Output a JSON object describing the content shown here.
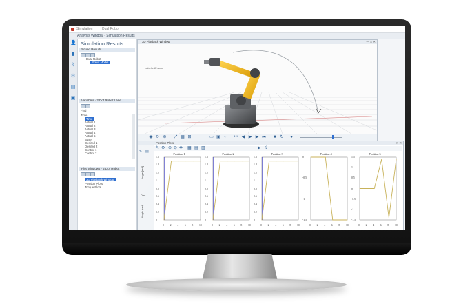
{
  "window": {
    "title": "Simulation",
    "subtitle": "Dual Robot",
    "tab": "Analysis Window · Simulation Results"
  },
  "left_panel": {
    "title": "Simulation Results",
    "sound_results": {
      "header": "Sound Results",
      "items": [
        "Dual Robot",
        "Robot Model"
      ]
    },
    "variables": {
      "header": "Variables · 2 Dof Robot Lane...",
      "filter_label": "Find",
      "tree_root": "Time",
      "items": [
        "Time",
        "Actual 1",
        "Actual 2",
        "Actual 3",
        "Actual 4",
        "Actual 5",
        "Base",
        "Desired 1",
        "Desired 2",
        "Control 1",
        "Control 2"
      ]
    },
    "plot_windows": {
      "header": "Plot Windows · 2 Dof Robot",
      "items": [
        "3D Playback Window",
        "Position Plots",
        "Torque Plots"
      ]
    }
  },
  "window_3d": {
    "title": "3D Playback Window",
    "scene_label": "LabelledFrame"
  },
  "plot_window": {
    "title": "Position Plots",
    "side_labels": [
      "Angle [rad]",
      "Dev",
      "Angle [rad]"
    ]
  },
  "colors": {
    "accent": "#2f6fd0",
    "robot_yellow": "#f2b418",
    "plot_line": "#c8b25a",
    "ref_line": "#2b2bd6",
    "bezel": "#1b1b1b"
  },
  "chart_data": [
    {
      "type": "line",
      "title": "Position 1",
      "x": [
        0,
        2,
        4,
        6,
        8,
        10
      ],
      "ylim": [
        0,
        1.6
      ],
      "yticks": [
        0,
        0.2,
        0.4,
        0.6,
        0.8,
        1,
        1.2,
        1.4,
        1.6
      ],
      "xticks": [
        0,
        2,
        4,
        6,
        8,
        10
      ],
      "series": [
        {
          "values": [
            0,
            1.5,
            1.5,
            1.5,
            1.5,
            1.5
          ]
        }
      ]
    },
    {
      "type": "line",
      "title": "Position 2",
      "x": [
        0,
        2,
        4,
        6,
        8,
        10
      ],
      "ylim": [
        0,
        1.6
      ],
      "yticks": [
        0,
        0.2,
        0.4,
        0.6,
        0.8,
        1,
        1.2,
        1.4,
        1.6
      ],
      "xticks": [
        0,
        2,
        4,
        6,
        8,
        10
      ],
      "series": [
        {
          "values": [
            0,
            1.5,
            1.5,
            1.5,
            1.5,
            1.5
          ]
        }
      ]
    },
    {
      "type": "line",
      "title": "Position 3",
      "x": [
        0,
        2,
        4,
        6,
        8,
        10
      ],
      "ylim": [
        0,
        1.6
      ],
      "yticks": [
        0,
        0.2,
        0.4,
        0.6,
        0.8,
        1,
        1.2,
        1.4,
        1.6
      ],
      "xticks": [
        0,
        2,
        4,
        6,
        8,
        10
      ],
      "series": [
        {
          "values": [
            0,
            1.5,
            1.5,
            1.5,
            1.5,
            1.5
          ]
        }
      ]
    },
    {
      "type": "line",
      "title": "Position 4",
      "x": [
        0,
        2,
        4,
        6,
        8,
        10
      ],
      "ylim": [
        -1.5,
        0
      ],
      "yticks": [
        0,
        -0.5,
        -1,
        -1.5
      ],
      "xticks": [
        0,
        2,
        4,
        6,
        8,
        10
      ],
      "series": [
        {
          "values": [
            0,
            0,
            0,
            -1.5,
            -1.5,
            -1.5
          ]
        }
      ]
    },
    {
      "type": "line",
      "title": "Position 5",
      "x": [
        0,
        2,
        4,
        6,
        8,
        10
      ],
      "ylim": [
        -1.5,
        1.5
      ],
      "yticks": [
        1.5,
        1,
        0.5,
        0,
        -0.5,
        -1,
        -1.5
      ],
      "xticks": [
        0,
        2,
        4,
        6,
        8,
        10
      ],
      "series": [
        {
          "values": [
            0,
            0,
            0,
            1.4,
            -1.4,
            1.4
          ]
        }
      ]
    }
  ]
}
